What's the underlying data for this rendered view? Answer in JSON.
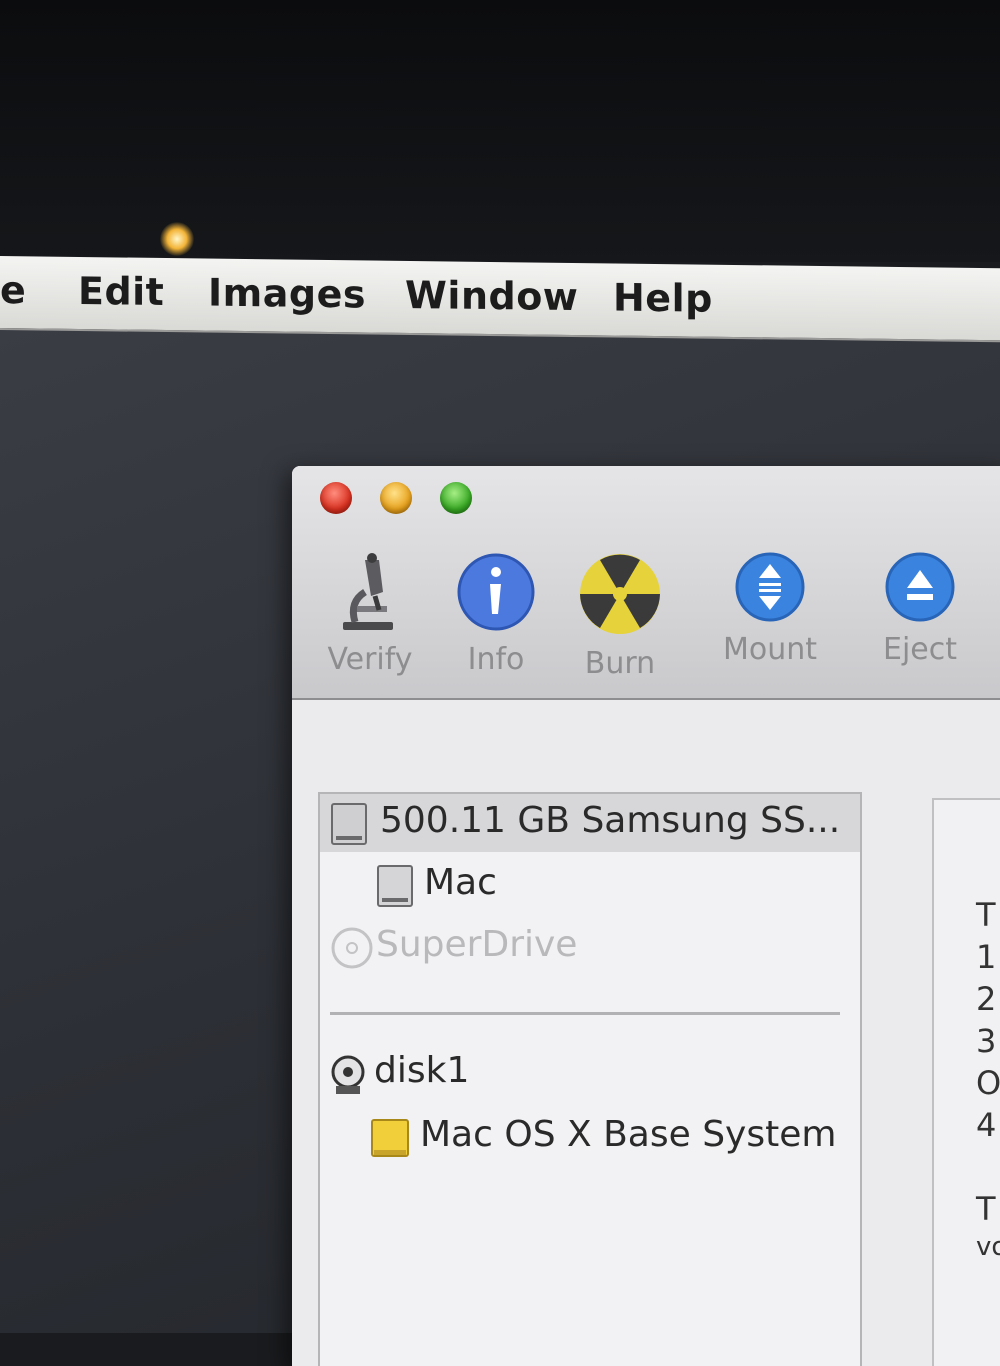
{
  "menu": {
    "items": [
      "e",
      "Edit",
      "Images",
      "Window",
      "Help"
    ]
  },
  "window": {
    "toolbar": {
      "verify": "Verify",
      "info": "Info",
      "burn": "Burn",
      "mount": "Mount",
      "eject": "Eject"
    },
    "sidebar": {
      "disk0": "500.11 GB Samsung SS...",
      "volume_mac": "Mac",
      "superdrive": "SuperDrive",
      "disk1": "disk1",
      "volume_base": "Mac OS X Base System"
    },
    "right_pane_fragments": [
      "T",
      "1",
      "2",
      "3",
      "O",
      "4",
      "T",
      "vo"
    ]
  },
  "colors": {
    "close": "#d8301f",
    "minimize": "#e7a11c",
    "zoom": "#37a823",
    "info_blue": "#3f6fd9",
    "mount_blue": "#3a84e0"
  }
}
